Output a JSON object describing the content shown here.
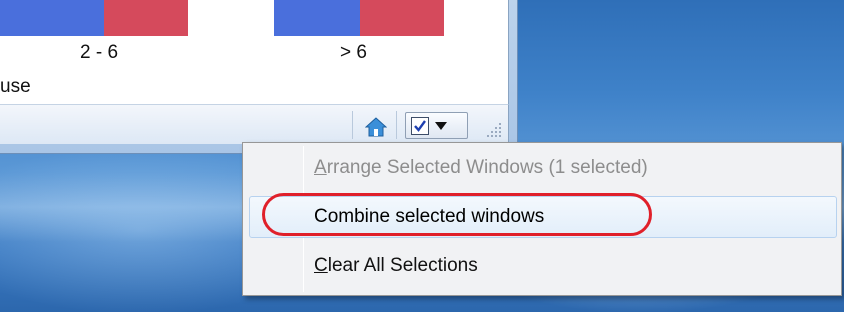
{
  "window": {
    "axis_ticks": [
      "2 - 6",
      "> 6"
    ],
    "legend_fragment": "use",
    "colors": {
      "bar_blue": "#4a6fdc",
      "bar_red": "#d54a5c"
    }
  },
  "statusbar": {
    "home_icon": "home-icon",
    "selection_icon": "checkbox-checked-icon",
    "dropdown_icon": "dropdown-arrow-icon",
    "grip_icon": "resize-grip-icon"
  },
  "context_menu": {
    "items": [
      {
        "label_accel": "A",
        "label_rest": "rrange Selected Windows (1 selected)",
        "state": "disabled"
      },
      {
        "label_accel": "",
        "label_rest": "Combine selected windows",
        "state": "highlighted"
      },
      {
        "label_accel": "C",
        "label_rest": "lear All Selections",
        "state": "normal"
      }
    ],
    "annotation_color": "#e0202a"
  }
}
